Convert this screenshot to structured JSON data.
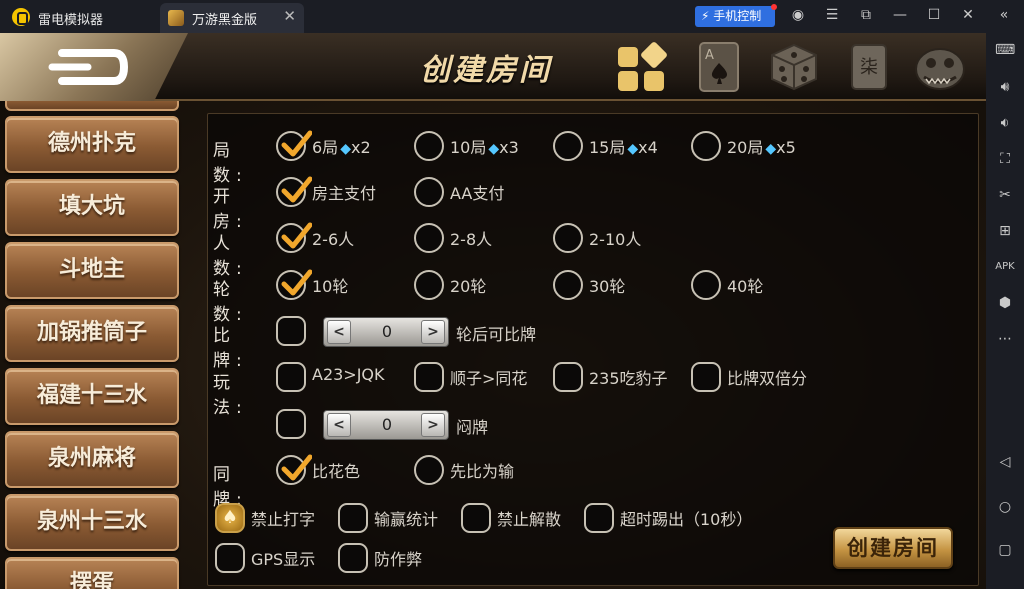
{
  "titlebar": {
    "app_name": "雷电模拟器",
    "tab_label": "万游黑金版",
    "phone_control": "手机控制"
  },
  "header": {
    "title": "创建房间"
  },
  "game_list": [
    "德州扑克",
    "填大坑",
    "斗地主",
    "加锅推筒子",
    "福建十三水",
    "泉州麻将",
    "泉州十三水",
    "摆蛋"
  ],
  "settings": {
    "rounds_label": "局 数:",
    "rounds_options": [
      {
        "text": "6局",
        "cost": "x2",
        "checked": true
      },
      {
        "text": "10局",
        "cost": "x3",
        "checked": false
      },
      {
        "text": "15局",
        "cost": "x4",
        "checked": false
      },
      {
        "text": "20局",
        "cost": "x5",
        "checked": false
      }
    ],
    "pay_label": "开 房:",
    "pay_options": [
      {
        "text": "房主支付",
        "checked": true
      },
      {
        "text": "AA支付",
        "checked": false
      }
    ],
    "players_label": "人 数:",
    "players_options": [
      {
        "text": "2-6人",
        "checked": true
      },
      {
        "text": "2-8人",
        "checked": false
      },
      {
        "text": "2-10人",
        "checked": false
      }
    ],
    "turns_label": "轮 数:",
    "turns_options": [
      {
        "text": "10轮",
        "checked": true
      },
      {
        "text": "20轮",
        "checked": false
      },
      {
        "text": "30轮",
        "checked": false
      },
      {
        "text": "40轮",
        "checked": false
      }
    ],
    "compare_label": "比 牌:",
    "compare_value": "0",
    "compare_suffix": "轮后可比牌",
    "play_label": "玩 法:",
    "play_options": [
      {
        "text": "A23>JQK",
        "checked": false
      },
      {
        "text": "顺子>同花",
        "checked": false
      },
      {
        "text": "235吃豹子",
        "checked": false
      },
      {
        "text": "比牌双倍分",
        "checked": false
      }
    ],
    "blind_value": "0",
    "blind_suffix": "闷牌",
    "tie_label": "同 牌:",
    "tie_options": [
      {
        "text": "比花色",
        "checked": true
      },
      {
        "text": "先比为输",
        "checked": false
      }
    ],
    "extra_options": [
      {
        "text": "禁止打字",
        "checked": true
      },
      {
        "text": "输赢统计",
        "checked": false
      },
      {
        "text": "禁止解散",
        "checked": false
      },
      {
        "text": "超时踢出（10秒）",
        "checked": false
      },
      {
        "text": "GPS显示",
        "checked": false
      },
      {
        "text": "防作弊",
        "checked": false
      }
    ]
  },
  "create_button": "创建房间",
  "icons": {
    "stepper_minus": "<",
    "stepper_plus": ">",
    "diamond": "💎",
    "spade": "♠"
  }
}
